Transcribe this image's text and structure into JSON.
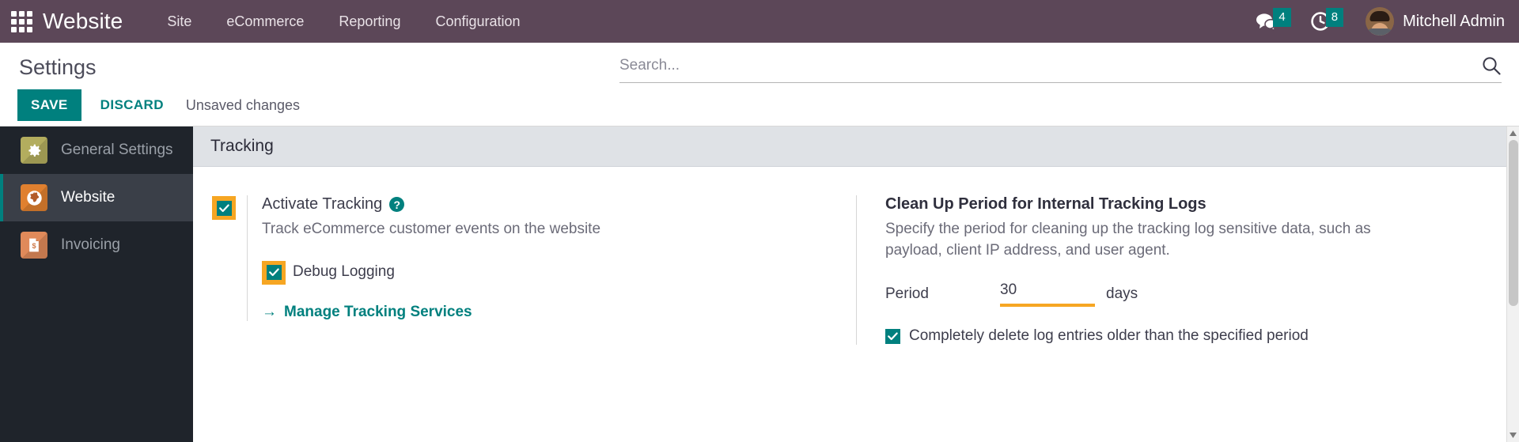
{
  "navbar": {
    "apps_icon": "apps-grid-icon",
    "brand": "Website",
    "menu": [
      {
        "label": "Site"
      },
      {
        "label": "eCommerce"
      },
      {
        "label": "Reporting"
      },
      {
        "label": "Configuration"
      }
    ],
    "messages": {
      "icon": "chat-bubble-icon",
      "count": "4"
    },
    "activities": {
      "icon": "clock-icon",
      "count": "8"
    },
    "user": {
      "name": "Mitchell Admin",
      "avatar": "user-avatar"
    },
    "colors": {
      "background": "#5c4758",
      "badge": "#00807e"
    }
  },
  "control_panel": {
    "title": "Settings",
    "save_label": "SAVE",
    "discard_label": "DISCARD",
    "status_text": "Unsaved changes",
    "search": {
      "placeholder": "Search...",
      "value": "",
      "icon": "search-icon"
    },
    "colors": {
      "save_button": "#00807e",
      "discard_text": "#00807e"
    }
  },
  "sidebar": {
    "items": [
      {
        "label": "General Settings",
        "icon": "gear-icon",
        "icon_class": "gear",
        "active": false
      },
      {
        "label": "Website",
        "icon": "globe-icon",
        "icon_class": "globe",
        "active": true
      },
      {
        "label": "Invoicing",
        "icon": "invoice-icon",
        "icon_class": "invoice",
        "active": false
      }
    ],
    "colors": {
      "background": "#1f242b",
      "active_background": "#3a3f48",
      "active_accent": "#00807e"
    }
  },
  "content": {
    "section_title": "Tracking",
    "left": {
      "activate_tracking": {
        "label": "Activate Tracking",
        "description": "Track eCommerce customer events on the website",
        "checked": true,
        "dirty": true,
        "help_icon": "question-mark-icon",
        "help_glyph": "?"
      },
      "debug_logging": {
        "label": "Debug Logging",
        "checked": true,
        "dirty": true
      },
      "manage_link": {
        "label": "Manage Tracking Services",
        "arrow": "→",
        "icon": "arrow-right-icon"
      }
    },
    "right": {
      "title": "Clean Up Period for Internal Tracking Logs",
      "description": "Specify the period for cleaning up the tracking log sensitive data, such as payload, client IP address, and user agent.",
      "period": {
        "label": "Period",
        "value": "30",
        "unit": "days",
        "dirty": true
      },
      "delete_option": {
        "label": "Completely delete log entries older than the specified period",
        "checked": true,
        "dirty": false
      }
    },
    "colors": {
      "section_header_bg": "#dfe2e6",
      "checkbox": "#00807e",
      "dirty_highlight": "#f6a623",
      "link": "#00807e"
    }
  },
  "scrollbar": {
    "up_arrow": "▲",
    "down_arrow": "▼"
  }
}
